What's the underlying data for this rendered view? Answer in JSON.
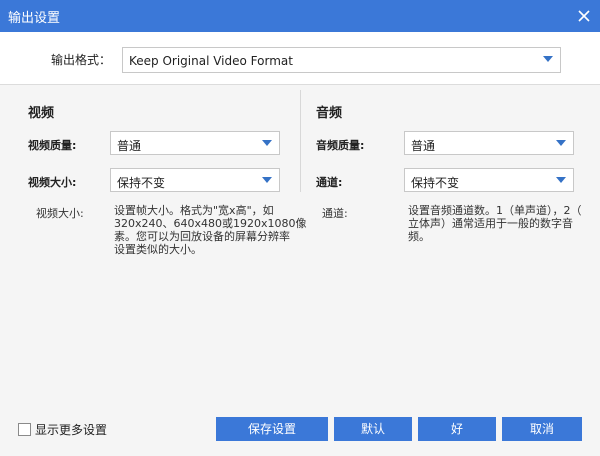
{
  "window": {
    "title": "输出设置"
  },
  "format": {
    "label": "输出格式：",
    "value": "Keep Original Video Format"
  },
  "video": {
    "section_title": "视频",
    "quality_label": "视频质量:",
    "quality_value": "普通",
    "size_label": "视频大小:",
    "size_value": "保持不变",
    "desc_label": "视频大小:",
    "desc_lines": [
      "设置帧大小。格式为\"宽x高\"，如",
      "320x240、640x480或1920x1080像",
      "素。您可以为回放设备的屏幕分辨率",
      "设置类似的大小。"
    ]
  },
  "audio": {
    "section_title": "音频",
    "quality_label": "音频质量:",
    "quality_value": "普通",
    "channel_label": "通道:",
    "channel_value": "保持不变",
    "desc_label": "通道:",
    "desc_lines": [
      "设置音频通道数。1（单声道），2（",
      "立体声）通常适用于一般的数字音",
      "频。"
    ]
  },
  "footer": {
    "show_more_label": "显示更多设置",
    "save_label": "保存设置",
    "default_label": "默认",
    "ok_label": "好",
    "cancel_label": "取消"
  },
  "colors": {
    "accent": "#3b78d8",
    "title_text": "#ffffff",
    "arrow": "#3572c6"
  }
}
